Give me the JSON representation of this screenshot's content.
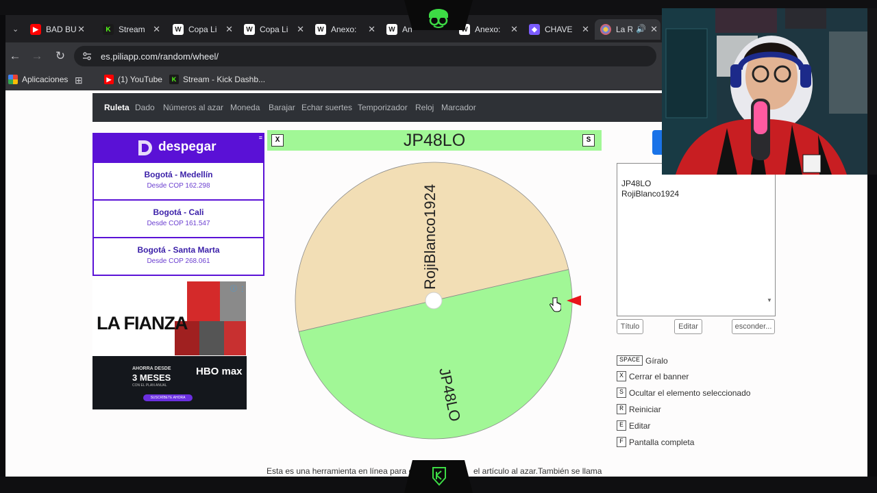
{
  "tabs": [
    {
      "label": "BAD BU",
      "icon": "youtube-icon",
      "color": "#ff0000"
    },
    {
      "label": "Stream",
      "icon": "kick-icon",
      "color": "#53fc18"
    },
    {
      "label": "Copa Li",
      "icon": "wikipedia-icon",
      "color": "#ffffff"
    },
    {
      "label": "Copa Li",
      "icon": "wikipedia-icon",
      "color": "#ffffff"
    },
    {
      "label": "Anexo:",
      "icon": "wikipedia-icon",
      "color": "#ffffff"
    },
    {
      "label": "An",
      "icon": "wikipedia-icon",
      "color": "#ffffff"
    },
    {
      "label": "Anexo:",
      "icon": "wikipedia-icon",
      "color": "#ffffff"
    },
    {
      "label": "CHAVE",
      "icon": "app-icon",
      "color": "#7b5cff"
    },
    {
      "label": "La R",
      "icon": "piliapp-icon",
      "color": "#8ab4f8"
    }
  ],
  "url": "es.piliapp.com/random/wheel/",
  "bookmarks": [
    {
      "label": "Aplicaciones",
      "icon": "apps-grid-icon"
    },
    {
      "label": "(1) YouTube",
      "icon": "youtube-icon"
    },
    {
      "label": "Stream - Kick Dashb...",
      "icon": "kick-icon"
    }
  ],
  "nav": [
    "Ruleta",
    "Dado",
    "Números al azar",
    "Moneda",
    "Barajar",
    "Echar suertes",
    "Temporizador",
    "Reloj",
    "Marcador"
  ],
  "ad": {
    "brand": "despegar",
    "routes": [
      {
        "route": "Bogotá - Medellín",
        "price": "Desde COP 162.298"
      },
      {
        "route": "Bogotá - Cali",
        "price": "Desde COP 161.547"
      },
      {
        "route": "Bogotá - Santa Marta",
        "price": "Desde COP 268.061"
      }
    ]
  },
  "ad2": {
    "title": "LA FIANZA",
    "offer_line1": "AHORRA DESDE",
    "offer_line2": "3 MESES",
    "offer_line3": "CON EL PLAN ANUAL",
    "hbo": "HBO max",
    "cta": "SUSCRÍBETE AHORA"
  },
  "wheel": {
    "result": "JP48LO",
    "close_key": "X",
    "hide_key": "S",
    "segments": [
      {
        "label": "RojiBlanco1924",
        "color": "#f2deb5"
      },
      {
        "label": "JP48LO",
        "color": "#a1f796"
      }
    ],
    "pointer_color": "#e8141b"
  },
  "entries": "JP48LO\nRojiBlanco1924",
  "buttons": {
    "title": "Título",
    "edit": "Editar",
    "hide": "esconder..."
  },
  "shortcuts": [
    {
      "key": "SPACE",
      "label": "Gíralo"
    },
    {
      "key": "X",
      "label": "Cerrar el banner"
    },
    {
      "key": "S",
      "label": "Ocultar el elemento seleccionado"
    },
    {
      "key": "R",
      "label": "Reiniciar"
    },
    {
      "key": "E",
      "label": "Editar"
    },
    {
      "key": "F",
      "label": "Pantalla completa"
    }
  ],
  "footer": "Esta es una herramienta en línea para el",
  "footer2": "el artículo al azar.También se llama"
}
